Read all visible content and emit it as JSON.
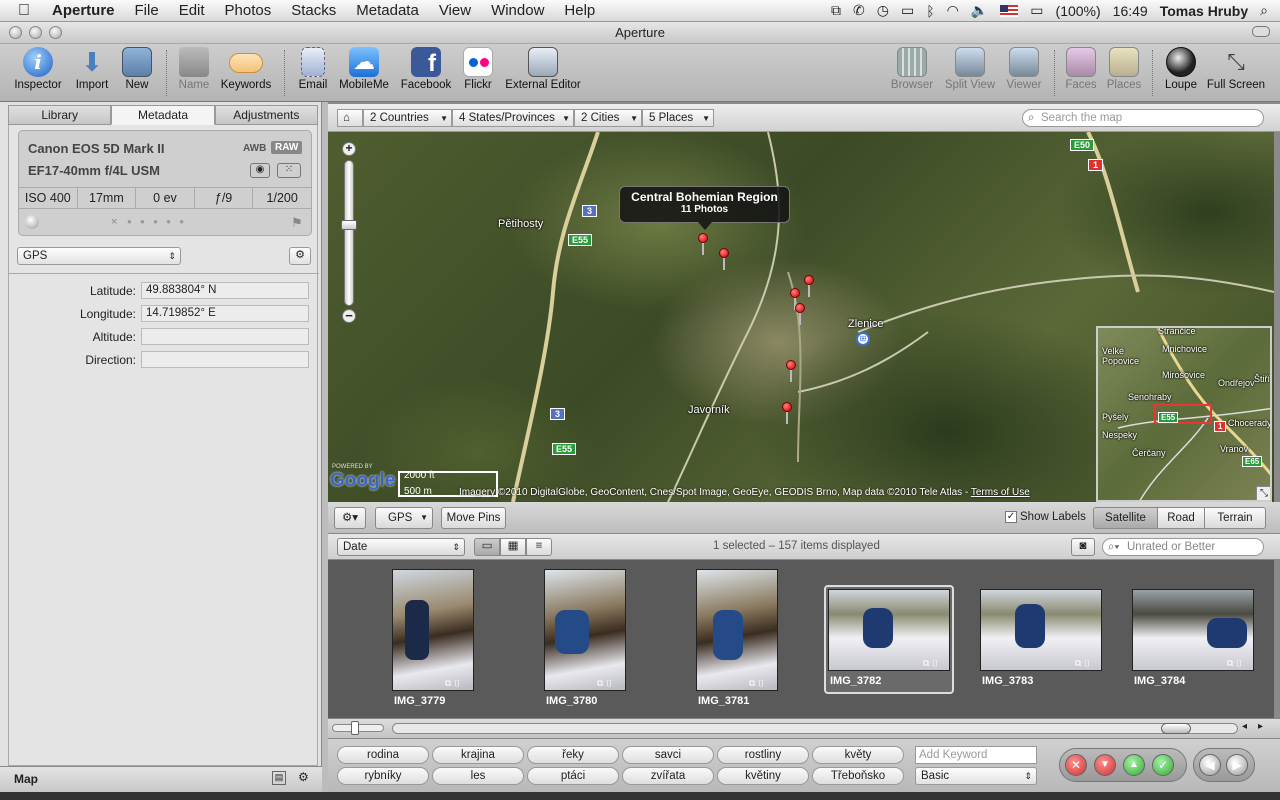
{
  "menubar": {
    "app": "Aperture",
    "items": [
      "File",
      "Edit",
      "Photos",
      "Stacks",
      "Metadata",
      "View",
      "Window",
      "Help"
    ],
    "battery": "(100%)",
    "time": "16:49",
    "user": "Tomas Hruby"
  },
  "window": {
    "title": "Aperture"
  },
  "toolbar": {
    "inspector": "Inspector",
    "import": "Import",
    "new": "New",
    "name": "Name",
    "keywords": "Keywords",
    "email": "Email",
    "mobileme": "MobileMe",
    "facebook": "Facebook",
    "flickr": "Flickr",
    "external_editor": "External Editor",
    "browser": "Browser",
    "split_view": "Split View",
    "viewer": "Viewer",
    "faces": "Faces",
    "places": "Places",
    "loupe": "Loupe",
    "full_screen": "Full Screen"
  },
  "tabs": {
    "library": "Library",
    "metadata": "Metadata",
    "adjustments": "Adjustments"
  },
  "camera": {
    "model": "Canon EOS 5D Mark II",
    "lens": "EF17-40mm f/4L USM",
    "awb": "AWB",
    "raw": "RAW",
    "iso": "ISO 400",
    "focal": "17mm",
    "ev": "0 ev",
    "aperture": "ƒ/9",
    "shutter": "1/200",
    "rating_x": "×",
    "dots": "● ● ● ● ●"
  },
  "metadata": {
    "preset": "GPS",
    "latitude_label": "Latitude:",
    "latitude": "49.883804° N",
    "longitude_label": "Longitude:",
    "longitude": "14.719852° E",
    "altitude_label": "Altitude:",
    "direction_label": "Direction:"
  },
  "mapbar": {
    "countries": "2 Countries",
    "states": "4 States/Provinces",
    "cities": "2 Cities",
    "places": "5 Places",
    "search_placeholder": "Search the map"
  },
  "map": {
    "callout_title": "Central Bohemian Region",
    "callout_sub": "11 Photos",
    "labels": [
      "Pětihosty",
      "Zlenice",
      "Javorník"
    ],
    "roads": [
      "E55",
      "3",
      "E50",
      "1",
      "E55",
      "3",
      "E55"
    ],
    "scale_ft": "2000 ft",
    "scale_m": "500 m",
    "attribution": "Imagery ©2010 DigitalGlobe, GeoContent, Cnes/Spot Image, GeoEye, GEODIS Brno, Map data ©2010 Tele Atlas - ",
    "terms": "Terms of Use",
    "google": "Google",
    "powered": "POWERED BY",
    "inset_labels": [
      "Strančice",
      "Velké Popovice",
      "Mnichovice",
      "Mirošovice",
      "Ondřejov",
      "Senohraby",
      "Pyšely",
      "Nespeky",
      "Čerčany",
      "Vranov",
      "Chocerady",
      "Štiřín"
    ],
    "inset_roads": [
      "E55",
      "1",
      "E65",
      "E55"
    ]
  },
  "maptools": {
    "gps": "GPS",
    "move_pins": "Move Pins",
    "show_labels": "Show Labels",
    "satellite": "Satellite",
    "road": "Road",
    "terrain": "Terrain"
  },
  "browserbar": {
    "sort": "Date",
    "status": "1 selected – 157 items displayed",
    "filter_placeholder": "Unrated or Better"
  },
  "thumbs": [
    "IMG_3779",
    "IMG_3780",
    "IMG_3781",
    "IMG_3782",
    "IMG_3783",
    "IMG_3784"
  ],
  "keywords": {
    "row1": [
      "rodina",
      "krajina",
      "řeky",
      "savci",
      "rostliny",
      "květy"
    ],
    "row2": [
      "rybníky",
      "les",
      "ptáci",
      "zvířata",
      "květiny",
      "Třeboňsko"
    ],
    "add_placeholder": "Add Keyword",
    "set": "Basic"
  },
  "leftbottom": {
    "label": "Map"
  }
}
